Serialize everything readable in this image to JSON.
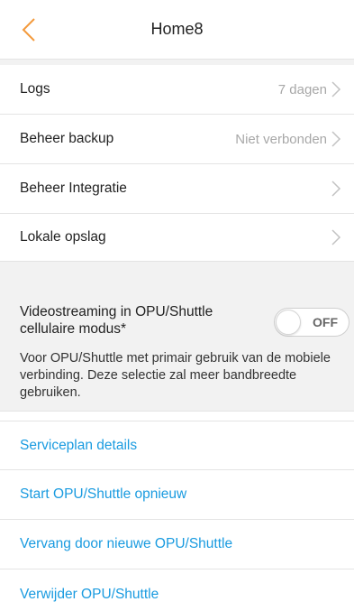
{
  "header": {
    "title": "Home8"
  },
  "settings": [
    {
      "label": "Logs",
      "value": "7 dagen"
    },
    {
      "label": "Beheer backup",
      "value": "Niet verbonden"
    },
    {
      "label": "Beheer Integratie",
      "value": ""
    },
    {
      "label": "Lokale opslag",
      "value": ""
    }
  ],
  "streaming": {
    "label": "Videostreaming in OPU/Shuttle cellulaire modus*",
    "toggle_state": "OFF",
    "description": "Voor OPU/Shuttle met primair gebruik van de mobiele verbinding. Deze selectie zal meer bandbreedte gebruiken."
  },
  "actions": [
    {
      "label": "Serviceplan details"
    },
    {
      "label": "Start OPU/Shuttle opnieuw"
    },
    {
      "label": "Vervang door nieuwe OPU/Shuttle"
    },
    {
      "label": "Verwijder OPU/Shuttle"
    }
  ],
  "colors": {
    "accent": "#f39a3c",
    "link": "#1a9be0",
    "section_bg": "#f2f2f2"
  },
  "icons": {
    "back": "chevron-left-icon",
    "row_arrow": "chevron-right-icon"
  }
}
